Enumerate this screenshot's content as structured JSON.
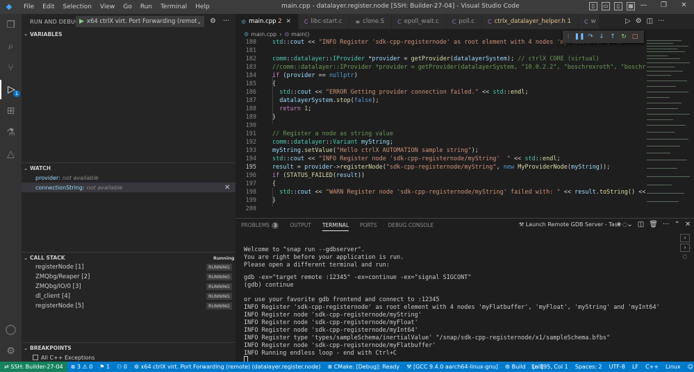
{
  "window": {
    "title": "main.cpp - datalayer.register.node [SSH: Builder-27-04] - Visual Studio Code",
    "menu": [
      "File",
      "Edit",
      "Selection",
      "View",
      "Go",
      "Run",
      "Terminal",
      "Help"
    ]
  },
  "activity": {
    "debug_badge": "1"
  },
  "sidebar": {
    "header": "RUN AND DEBUG",
    "config": "x64 ctrlX virt. Port Forwarding (remote)",
    "variables": "VARIABLES",
    "watch": {
      "title": "WATCH",
      "items": [
        {
          "name": "provider:",
          "value": "not available"
        },
        {
          "name": "connectionString:",
          "value": "not available"
        }
      ]
    },
    "callstack": {
      "title": "CALL STACK",
      "status": "Running",
      "items": [
        {
          "name": "registerNode [1]",
          "state": "RUNNING"
        },
        {
          "name": "ZMQbg/Reaper [2]",
          "state": "RUNNING"
        },
        {
          "name": "ZMQbg/IO/0 [3]",
          "state": "RUNNING"
        },
        {
          "name": "dl_client [4]",
          "state": "RUNNING"
        },
        {
          "name": "registerNode [5]",
          "state": "RUNNING"
        }
      ]
    },
    "breakpoints": {
      "title": "BREAKPOINTS",
      "item": "All C++ Exceptions"
    }
  },
  "tabs": [
    {
      "label": "main.cpp",
      "mod": "2",
      "active": true
    },
    {
      "label": "libc-start.c"
    },
    {
      "label": "clone.S"
    },
    {
      "label": "epoll_wait.c"
    },
    {
      "label": "poll.c"
    },
    {
      "label": "ctrlx_datalayer_helper.h",
      "mod": "1"
    },
    {
      "label": "w"
    }
  ],
  "breadcrumb": {
    "file": "main.cpp",
    "symbol": "main()"
  },
  "editor": {
    "line_numbers": [
      "180",
      "181",
      "182",
      "183",
      "184",
      "185",
      "186",
      "187",
      "188",
      "189",
      "190",
      "191",
      "192",
      "193",
      "194",
      "195",
      "196",
      "197",
      "198",
      "199",
      "200"
    ],
    "current_line": "195"
  },
  "panel": {
    "tabs": {
      "problems": "PROBLEMS",
      "problems_count": "3",
      "output": "OUTPUT",
      "terminal": "TERMINAL",
      "ports": "PORTS",
      "debug_console": "DEBUG CONSOLE"
    },
    "task": "Launch Remote GDB Server - Task",
    "terminal_lines": [
      "Welcome to \"snap run --gdbserver\".",
      "You are right before your application is run.",
      "Please open a different terminal and run:",
      "",
      "gdb -ex=\"target remote :12345\" -ex=continue -ex=\"signal SIGCONT\"",
      "(gdb) continue",
      "",
      "or use your favorite gdb frontend and connect to :12345",
      "INFO Register 'sdk-cpp-registernode' as root element with 4 nodes 'myFlatbuffer', 'myFloat', 'myString' and 'myInt64'",
      "INFO Register node 'sdk-cpp-registernode/myString'",
      "INFO Register node 'sdk-cpp-registernode/myFloat'",
      "INFO Register node 'sdk-cpp-registernode/myInt64'",
      "INFO Register type 'types/sampleSchema/inertialValue' \"/snap/sdk-cpp-registernode/x1/sampleSchema.bfbs\"",
      "INFO Register node 'sdk-cpp-registernode/myFlatbuffer'",
      "INFO Running endless loop - end with Ctrl+C"
    ]
  },
  "status": {
    "remote": "SSH: Builder-27-04",
    "errors": "3",
    "warnings": "0",
    "info": "1",
    "ports": "0",
    "debug": "x64 ctrlX virt. Port Forwarding (remote) (datalayer.register.node)",
    "cmake": "CMake: [Debug]: Ready",
    "kit": "[GCC 9.4.0 aarch64-linux-gnu]",
    "build": "Build",
    "all": "[all]",
    "position": "Ln 195, Col 1",
    "spaces": "Spaces: 2",
    "encoding": "UTF-8",
    "eol": "LF",
    "lang": "C++",
    "os": "Linux"
  },
  "colors": {
    "accent": "#007acc",
    "remote": "#16825d"
  }
}
